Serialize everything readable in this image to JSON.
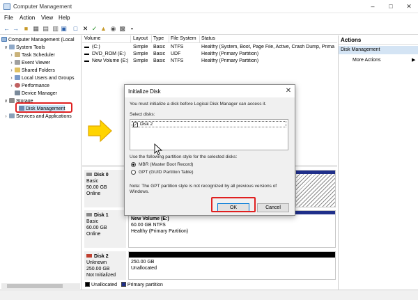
{
  "window": {
    "title": "Computer Management",
    "controls": {
      "minimize": "–",
      "maximize": "□",
      "close": "✕"
    }
  },
  "menu": [
    "File",
    "Action",
    "View",
    "Help"
  ],
  "toolbar": {
    "icons": [
      "back-icon",
      "forward-icon",
      "up-folder-icon",
      "console-tree-icon",
      "properties-icon",
      "help-icon",
      "delete-icon",
      "check-icon",
      "open-folder-icon",
      "search-icon",
      "save-icon",
      "settings-icon"
    ]
  },
  "tree": {
    "root": "Computer Management (Local",
    "system_tools": "System Tools",
    "task_scheduler": "Task Scheduler",
    "event_viewer": "Event Viewer",
    "shared_folders": "Shared Folders",
    "local_users": "Local Users and Groups",
    "performance": "Performance",
    "device_manager": "Device Manager",
    "storage": "Storage",
    "disk_management": "Disk Management",
    "services": "Services and Applications"
  },
  "volumes": {
    "headers": [
      "Volume",
      "Layout",
      "Type",
      "File System",
      "Status"
    ],
    "rows": [
      [
        "(C:)",
        "Simple",
        "Basic",
        "NTFS",
        "Healthy (System, Boot, Page File, Active, Crash Dump, Prima"
      ],
      [
        "DVD_ROM (E:)",
        "Simple",
        "Basic",
        "UDF",
        "Healthy (Primary Partition)"
      ],
      [
        "New Volume (E:)",
        "Simple",
        "Basic",
        "NTFS",
        "Healthy (Primary Partition)"
      ]
    ]
  },
  "disks": [
    {
      "name": "Disk 0",
      "type": "Basic",
      "size": "50.00 GB",
      "status": "Online"
    },
    {
      "name": "Disk 1",
      "type": "Basic",
      "size": "60.00 GB",
      "status": "Online",
      "partition": {
        "name": "New Volume (E:)",
        "size": "60.00 GB NTFS",
        "status": "Healthy (Primary Partition)"
      }
    },
    {
      "name": "Disk 2",
      "type": "Unknown",
      "size": "250.00 GB",
      "status": "Not Initialized",
      "partition": {
        "size": "250.00 GB",
        "status": "Unallocated"
      }
    }
  ],
  "legend": {
    "unallocated": "Unallocated",
    "primary": "Primary partition"
  },
  "actions": {
    "header": "Actions",
    "section": "Disk Management",
    "more": "More Actions"
  },
  "dialog": {
    "title": "Initialize Disk",
    "close": "✕",
    "intro": "You must initialize a disk before Logical Disk Manager can access it.",
    "select_label": "Select disks:",
    "disk_item": "Disk 2",
    "style_label": "Use the following partition style for the selected disks:",
    "mbr": "MBR (Master Boot Record)",
    "gpt": "GPT (GUID Partition Table)",
    "note_line1": "Note: The GPT partition style is not recognized by all previous versions of",
    "note_line2": "Windows.",
    "ok": "OK",
    "cancel": "Cancel"
  },
  "colors": {
    "primary_partition": "#1f2f8a",
    "unallocated": "#000000",
    "annotation_red": "#e02020",
    "annotation_yellow": "#ffd400"
  }
}
